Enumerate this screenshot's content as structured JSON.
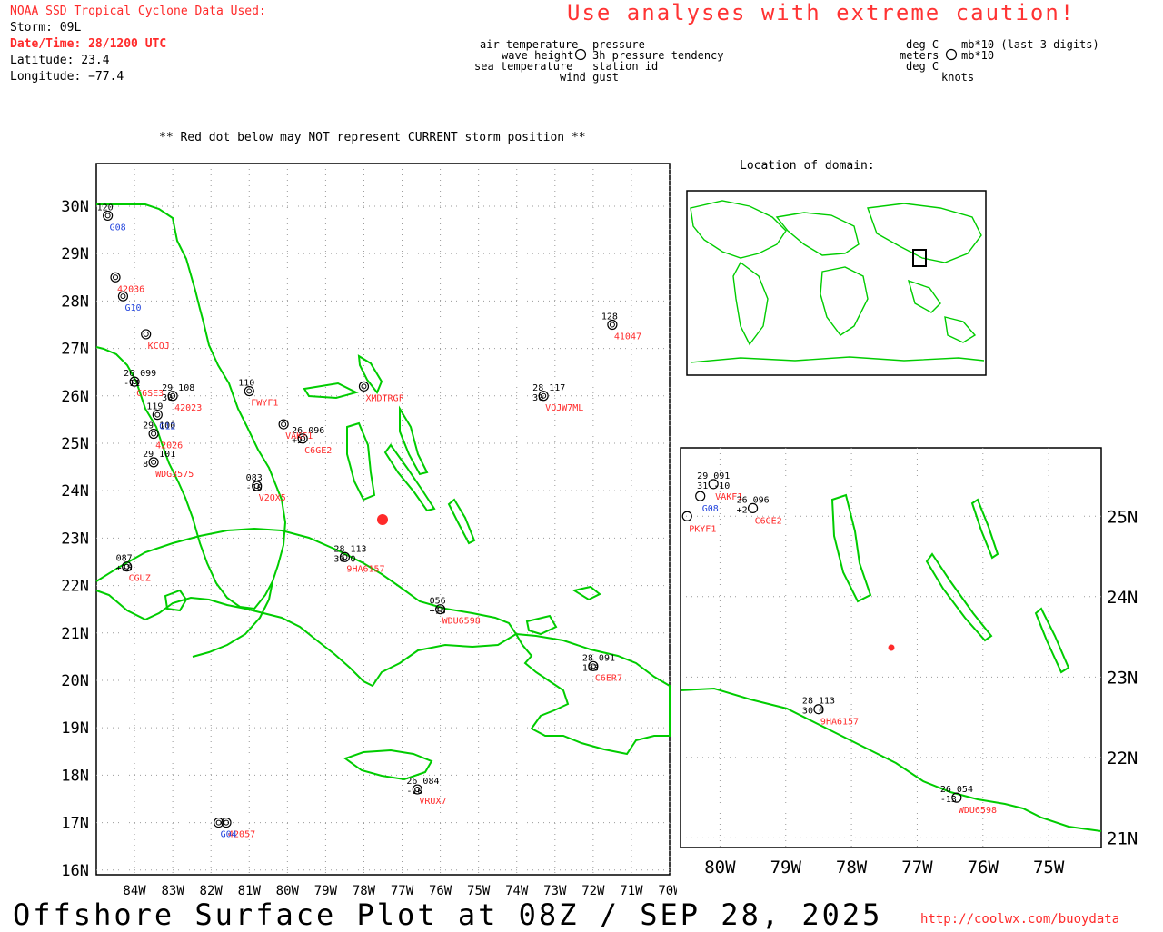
{
  "header": {
    "source_title": "NOAA SSD Tropical Cyclone Data Used:",
    "storm": "Storm: 09L",
    "datetime": "Date/Time: 28/1200 UTC",
    "latitude": "Latitude: 23.4",
    "longitude": "Longitude: −77.4"
  },
  "warning": "Use analyses with extreme caution!",
  "legend": {
    "left_col": [
      "air temperature",
      "wave height",
      "sea temperature"
    ],
    "right_col": [
      "pressure",
      "3h pressure tendency",
      "station id"
    ],
    "bottom": "wind gust",
    "units_left": [
      "deg C",
      "meters",
      "deg C"
    ],
    "units_right": [
      "mb*10 (last 3 digits)",
      "mb*10",
      "knots"
    ]
  },
  "red_dot_note": "** Red dot below may NOT represent CURRENT storm position **",
  "domain_label": "Location of domain:",
  "main_map": {
    "lat_labels": [
      "30N",
      "29N",
      "28N",
      "27N",
      "26N",
      "25N",
      "24N",
      "23N",
      "22N",
      "21N",
      "20N",
      "19N",
      "18N",
      "17N",
      "16N"
    ],
    "lon_labels": [
      "84W",
      "83W",
      "82W",
      "81W",
      "80W",
      "79W",
      "78W",
      "77W",
      "76W",
      "75W",
      "74W",
      "73W",
      "72W",
      "71W",
      "70W"
    ],
    "storm_position": {
      "lat": 23.4,
      "lon": -77.4
    },
    "stations": [
      {
        "id": "41047",
        "lat": 27.5,
        "lon": -71.5,
        "text": "128",
        "color": "#ff2a2a"
      },
      {
        "id": "VQJW7ML",
        "lat": 26.0,
        "lon": -73.3,
        "text": "28 117 / 30",
        "color": "#ff2a2a"
      },
      {
        "id": "42036",
        "lat": 28.5,
        "lon": -84.5,
        "text": "",
        "color": "#ff2a2a"
      },
      {
        "id": "42023",
        "lat": 26.0,
        "lon": -83.0,
        "text": "29 108 / 30",
        "color": "#ff2a2a"
      },
      {
        "id": "42026",
        "lat": 25.2,
        "lon": -83.5,
        "text": "29 100",
        "color": "#ff2a2a"
      },
      {
        "id": "42057",
        "lat": 17.0,
        "lon": -81.6,
        "text": "",
        "color": "#ff2a2a"
      },
      {
        "id": "9HA6157",
        "lat": 22.6,
        "lon": -78.5,
        "text": "28 113 / 30 0",
        "color": "#ff2a2a"
      },
      {
        "id": "WDU6598",
        "lat": 21.5,
        "lon": -76.0,
        "text": "056 / +18",
        "color": "#ff2a2a"
      },
      {
        "id": "C6ER7",
        "lat": 20.3,
        "lon": -72.0,
        "text": "28 091 / 103",
        "color": "#ff2a2a"
      },
      {
        "id": "VRUX7",
        "lat": 17.7,
        "lon": -76.6,
        "text": "26 084 / -10",
        "color": "#ff2a2a"
      },
      {
        "id": "V2QX5",
        "lat": 24.1,
        "lon": -80.8,
        "text": "083 / -10",
        "color": "#ff2a2a"
      },
      {
        "id": "C6GE2",
        "lat": 25.1,
        "lon": -79.6,
        "text": "26 096 / +2",
        "color": "#ff2a2a"
      },
      {
        "id": "VAKF1",
        "lat": 25.4,
        "lon": -80.1,
        "text": "",
        "color": "#ff2a2a"
      },
      {
        "id": "FWYF1",
        "lat": 26.1,
        "lon": -81.0,
        "text": "110",
        "color": "#ff2a2a"
      },
      {
        "id": "KCOJ",
        "lat": 27.3,
        "lon": -83.7,
        "text": "",
        "color": "#ff2a2a"
      },
      {
        "id": "C6SE3",
        "lat": 26.3,
        "lon": -84.0,
        "text": "26 099 / -11",
        "color": "#ff2a2a"
      },
      {
        "id": "WDG3575",
        "lat": 24.6,
        "lon": -83.5,
        "text": "29 101 / 8",
        "color": "#ff2a2a"
      },
      {
        "id": "CGUZ",
        "lat": 22.4,
        "lon": -84.2,
        "text": "087 / +18",
        "color": "#ff2a2a"
      },
      {
        "id": "XMDTRGF",
        "lat": 26.2,
        "lon": -78.0,
        "text": "",
        "color": "#ff2a2a"
      },
      {
        "id": "G08",
        "lat": 29.8,
        "lon": -84.7,
        "text": "120",
        "color": "#2244dd"
      },
      {
        "id": "G04",
        "lat": 17.0,
        "lon": -81.8,
        "text": "",
        "color": "#2244dd"
      },
      {
        "id": "G10",
        "lat": 28.1,
        "lon": -84.3,
        "text": "",
        "color": "#2244dd"
      },
      {
        "id": "G12",
        "lat": 25.6,
        "lon": -83.4,
        "text": "119",
        "color": "#2244dd"
      }
    ]
  },
  "inset_map": {
    "lat_labels": [
      "25N",
      "24N",
      "23N",
      "22N",
      "21N"
    ],
    "lon_labels": [
      "80W",
      "79W",
      "78W",
      "77W",
      "76W",
      "75W"
    ],
    "stations": [
      {
        "id": "VAKF1",
        "text": "29 091 / 31 -10",
        "color": "#ff2a2a"
      },
      {
        "id": "C6GE2",
        "text": "26 096 / +2",
        "color": "#ff2a2a"
      },
      {
        "id": "PKYF1",
        "text": "",
        "color": "#ff2a2a"
      },
      {
        "id": "9HA6157",
        "text": "28 113 / 30 0",
        "color": "#ff2a2a"
      },
      {
        "id": "WDU6598",
        "text": "26 054 / -13",
        "color": "#ff2a2a"
      },
      {
        "id": "G08",
        "text": "",
        "color": "#2244dd"
      }
    ]
  },
  "footer": {
    "title": "Offshore Surface Plot at 08Z / SEP 28, 2025",
    "url": "http://coolwx.com/buoydata"
  },
  "colors": {
    "land": "#00cc00",
    "red": "#ff2a2a",
    "blue": "#2244dd",
    "grid": "#999999"
  }
}
